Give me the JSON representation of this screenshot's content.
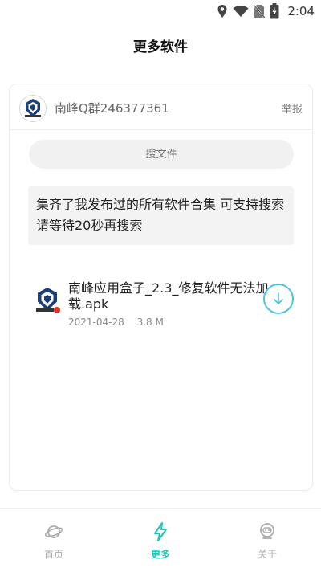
{
  "status_bar": {
    "time": "2:04"
  },
  "title": "更多软件",
  "group": {
    "name": "南峰Q群246377361",
    "report_label": "举报"
  },
  "search": {
    "placeholder": "搜文件"
  },
  "message": "集齐了我发布过的所有软件合集 可支持搜索 请等待20秒再搜索",
  "files": [
    {
      "name": "南峰应用盒子_2.3_修复软件无法加载.apk",
      "date": "2021-04-28",
      "size": "3.8 M"
    }
  ],
  "bottom_nav": {
    "items": [
      {
        "label": "首页",
        "icon": "planet-icon"
      },
      {
        "label": "更多",
        "icon": "lightning-icon",
        "active": true
      },
      {
        "label": "关于",
        "icon": "robot-icon"
      }
    ]
  },
  "colors": {
    "accent": "#21c4b5",
    "download": "#4fc1df"
  }
}
